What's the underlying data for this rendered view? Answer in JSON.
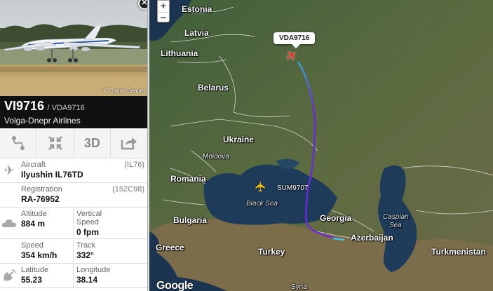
{
  "photo": {
    "credit": "© Carlos Seabra"
  },
  "flight": {
    "number": "VI9716",
    "callsign": "/ VDA9716",
    "airline": "Volga-Dnepr Airlines"
  },
  "tools": [
    "route",
    "fit",
    "3D",
    "share"
  ],
  "tool_3d_label": "3D",
  "details": {
    "aircraft_label": "Aircraft",
    "aircraft_code": "(IL76)",
    "aircraft_value": "Ilyushin IL76TD",
    "registration_label": "Registration",
    "registration_code": "(152C98)",
    "registration_value": "RA-76952",
    "altitude_label": "Altitude",
    "altitude_value": "884 m",
    "vspeed_label": "Vertical Speed",
    "vspeed_value": "0 fpm",
    "speed_label": "Speed",
    "speed_value": "354 km/h",
    "track_label": "Track",
    "track_value": "332°",
    "latitude_label": "Latitude",
    "latitude_value": "55.23",
    "longitude_label": "Longitude",
    "longitude_value": "38.14"
  },
  "map": {
    "zoom_in": "+",
    "zoom_out": "−",
    "selected_callsign": "VDA9716",
    "other_callsign": "SUM9707",
    "google": "Google",
    "labels": {
      "estonia": "Estonia",
      "latvia": "Latvia",
      "lithuania": "Lithuania",
      "belarus": "Belarus",
      "ukraine": "Ukraine",
      "moldova": "Moldova",
      "romania": "Romania",
      "black_sea": "Black Sea",
      "bulgaria": "Bulgaria",
      "georgia": "Georgia",
      "greece": "Greece",
      "turkey": "Turkey",
      "azerbaijan": "Azerbaijan",
      "caspian": "Caspian",
      "sea": "Sea",
      "turkmenistan": "Turkmenistan",
      "syria": "Syria"
    },
    "colors": {
      "track_start": "#3aa6d6",
      "track_end": "#6a2cd8",
      "plane": "#e8261c",
      "other_plane": "#f2c200"
    }
  }
}
